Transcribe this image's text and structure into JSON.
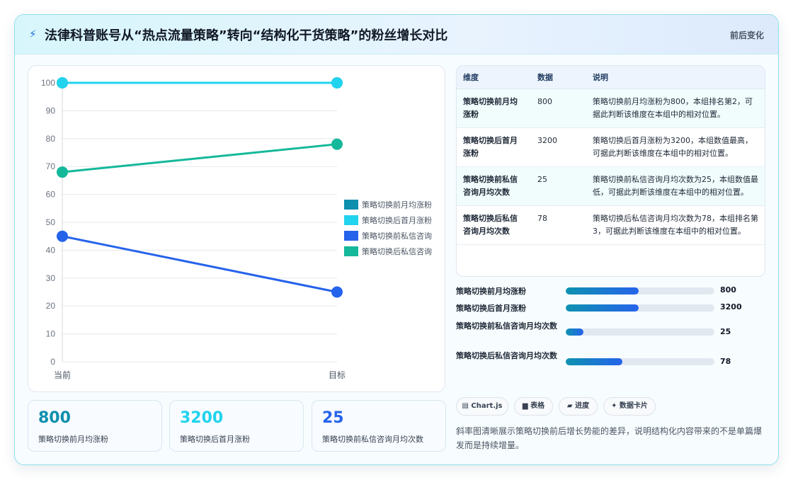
{
  "header": {
    "icon": "lightning-icon",
    "title": "法律科普账号从“热点流量策略”转向“结构化干货策略”的粉丝增长对比",
    "tag": "前后变化"
  },
  "chart_data": {
    "type": "line",
    "categories": [
      "当前",
      "目标"
    ],
    "ylim": [
      0,
      100
    ],
    "yticks": [
      0,
      10,
      20,
      30,
      40,
      50,
      60,
      70,
      80,
      90,
      100
    ],
    "grid": true,
    "legend_position": "right",
    "series": [
      {
        "name": "策略切换前月均涨粉",
        "values": [
          100,
          100
        ],
        "color": "#0e8fad"
      },
      {
        "name": "策略切换后首月涨粉",
        "values": [
          100,
          100
        ],
        "color": "#22d3ee"
      },
      {
        "name": "策略切换前私信咨询",
        "values": [
          45,
          25
        ],
        "color": "#2563eb"
      },
      {
        "name": "策略切换后私信咨询",
        "values": [
          68,
          78
        ],
        "color": "#14b89a"
      }
    ]
  },
  "stats": [
    {
      "value": "800",
      "label": "策略切换前月均涨粉",
      "color": "#0e8fad"
    },
    {
      "value": "3200",
      "label": "策略切换后首月涨粉",
      "color": "#22d3ee"
    },
    {
      "value": "25",
      "label": "策略切换前私信咨询月均次数",
      "color": "#2563eb"
    }
  ],
  "table": {
    "headers": [
      "维度",
      "数据",
      "说明"
    ],
    "rows": [
      {
        "dim": "策略切换前月均涨粉",
        "val": "800",
        "desc": "策略切换前月均涨粉为800，本组排名第2，可据此判断该维度在本组中的相对位置。"
      },
      {
        "dim": "策略切换后首月涨粉",
        "val": "3200",
        "desc": "策略切换后首月涨粉为3200，本组数值最高，可据此判断该维度在本组中的相对位置。"
      },
      {
        "dim": "策略切换前私信咨询月均次数",
        "val": "25",
        "desc": "策略切换前私信咨询月均次数为25，本组数值最低，可据此判断该维度在本组中的相对位置。"
      },
      {
        "dim": "策略切换后私信咨询月均次数",
        "val": "78",
        "desc": "策略切换后私信咨询月均次数为78，本组排名第3，可据此判断该维度在本组中的相对位置。"
      }
    ]
  },
  "progress": [
    {
      "label": "策略切换前月均涨粉",
      "value": "800",
      "fraction": 0.49
    },
    {
      "label": "策略切换后首月涨粉",
      "value": "3200",
      "fraction": 0.49
    },
    {
      "label": "策略切换前私信咨询月均次数",
      "value": "25",
      "fraction": 0.12
    },
    {
      "label": "策略切换后私信咨询月均次数",
      "value": "78",
      "fraction": 0.38
    }
  ],
  "chips": [
    {
      "icon": "window-icon",
      "label": "▤ Chart.js"
    },
    {
      "icon": "table-icon",
      "label": "▆ 表格"
    },
    {
      "icon": "progress-icon",
      "label": "▰ 进度"
    },
    {
      "icon": "sparkle-icon",
      "label": "✦ 数据卡片"
    }
  ],
  "note": "斜率图清晰展示策略切换前后增长势能的差异，说明结构化内容带来的不是单篇爆发而是持续增量。"
}
